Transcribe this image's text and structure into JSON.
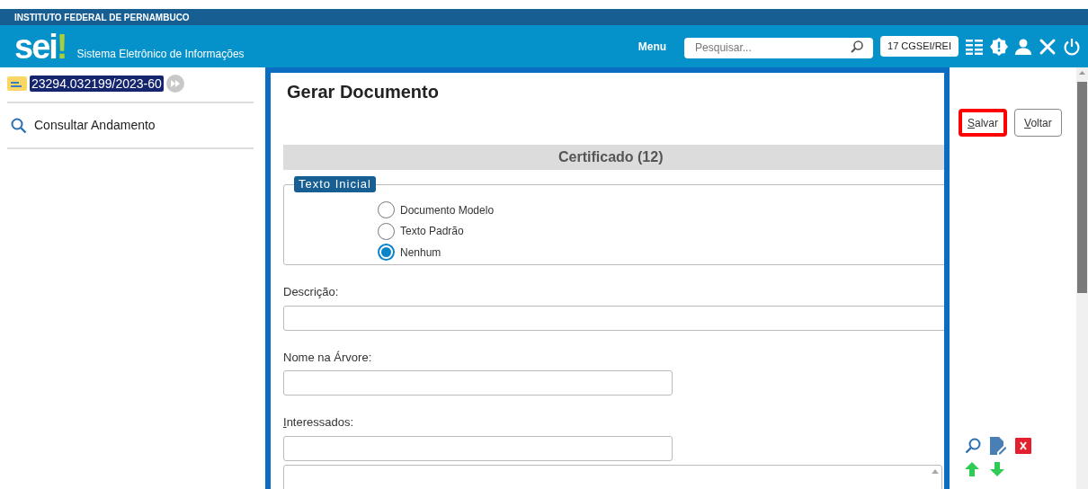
{
  "header": {
    "institution": "INSTITUTO FEDERAL DE PERNAMBUCO",
    "logo": "sei",
    "logo_mark": "!",
    "system_name": "Sistema Eletrônico de Informações",
    "menu": "Menu",
    "search": {
      "placeholder": "Pesquisar..."
    },
    "unit": "17 CGSEI/REI"
  },
  "sidebar": {
    "process_number": "23294.032199/2023-60",
    "items": [
      {
        "label": "Consultar Andamento"
      }
    ]
  },
  "form": {
    "title": "Gerar Documento",
    "document_type": "Certificado (12)",
    "fieldset": "Texto Inicial",
    "options": [
      {
        "label": "Documento Modelo",
        "selected": false
      },
      {
        "label": "Texto Padrão",
        "selected": false
      },
      {
        "label": "Nenhum",
        "selected": true
      }
    ],
    "fields": [
      {
        "label": "Descrição:",
        "kind": "wide",
        "underline_first": false
      },
      {
        "label": "Nome na Árvore:",
        "kind": "short",
        "underline_first": false
      },
      {
        "label": "Interessados:",
        "kind": "short",
        "underline_first": true
      }
    ]
  },
  "actions": [
    {
      "label": "Salvar",
      "kind": "primary",
      "underline_first": true
    },
    {
      "label": "Voltar",
      "kind": "secondary",
      "underline_first": true
    }
  ]
}
